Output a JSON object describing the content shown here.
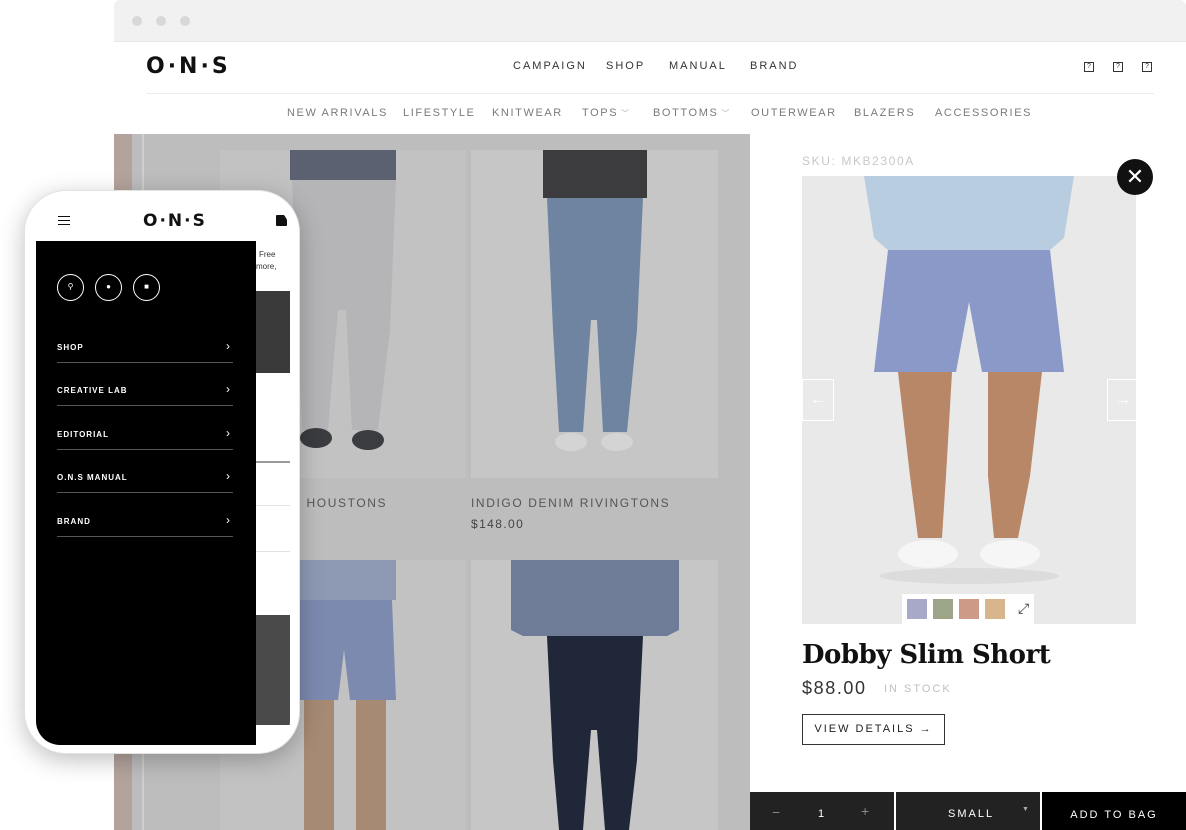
{
  "site": {
    "logo": "O·N·S",
    "main_nav": [
      "CAMPAIGN",
      "SHOP",
      "MANUAL",
      "BRAND"
    ],
    "header_icons": [
      "search-icon",
      "account-icon",
      "bag-icon"
    ],
    "sub_nav": [
      {
        "label": "NEW ARRIVALS",
        "has_dropdown": false
      },
      {
        "label": "LIFESTYLE",
        "has_dropdown": false
      },
      {
        "label": "KNITWEAR",
        "has_dropdown": false
      },
      {
        "label": "TOPS",
        "has_dropdown": true
      },
      {
        "label": "BOTTOMS",
        "has_dropdown": true
      },
      {
        "label": "OUTERWEAR",
        "has_dropdown": false
      },
      {
        "label": "BLAZERS",
        "has_dropdown": false
      },
      {
        "label": "ACCESSORIES",
        "has_dropdown": false
      }
    ]
  },
  "grid": {
    "products": [
      {
        "name": "M HOUSTONS",
        "price": ""
      },
      {
        "name": "INDIGO DENIM RIVINGTONS",
        "price": "$148.00"
      }
    ]
  },
  "quickview": {
    "sku": "SKU: MKB2300A",
    "close_icon": "close-icon",
    "prev_icon": "arrow-left-icon",
    "next_icon": "arrow-right-icon",
    "swatches": [
      "#a8a8c8",
      "#9ca58a",
      "#cc9a86",
      "#d8b58c"
    ],
    "expand_icon": "expand-icon",
    "name": "Dobby Slim Short",
    "price": "$88.00",
    "stock": "IN STOCK",
    "view_details": "VIEW DETAILS →",
    "quantity": "1",
    "qty_minus": "−",
    "qty_plus": "+",
    "size": "SMALL",
    "add_to_bag": "ADD TO BAG"
  },
  "mobile": {
    "logo": "O·N·S",
    "menu_icon": "hamburger-icon",
    "bag_icon": "bag-icon",
    "circle_icons": [
      "search-icon",
      "account-icon",
      "bag-icon"
    ],
    "menu_items": [
      "SHOP",
      "CREATIVE LAB",
      "EDITORIAL",
      "O.N.S MANUAL",
      "BRAND"
    ],
    "peek_text": [
      "Free",
      "more,"
    ]
  },
  "colors": {
    "accent": "#000000",
    "overlay_grey": "#bdbdbd",
    "shorts_blue": "#8a98c4"
  }
}
